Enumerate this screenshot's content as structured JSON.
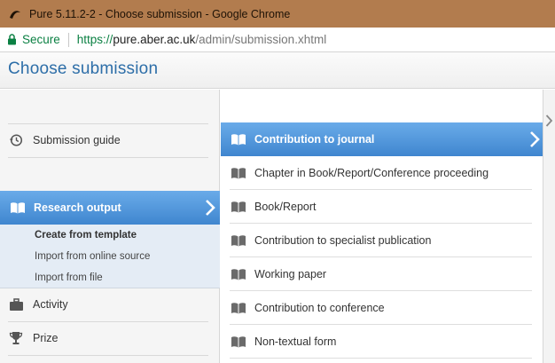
{
  "window": {
    "title": "Pure 5.11.2-2 - Choose submission - Google Chrome",
    "icon": "pure-logo-icon"
  },
  "addressbar": {
    "secure_label": "Secure",
    "url_scheme": "https://",
    "url_host": "pure.aber.ac.uk",
    "url_path": "/admin/submission.xhtml"
  },
  "page": {
    "title": "Choose submission"
  },
  "left_menu": {
    "submission_guide": {
      "label": "Submission guide",
      "icon": "history-icon"
    },
    "research_output": {
      "label": "Research output",
      "icon": "book-icon"
    },
    "sub_items": [
      {
        "label": "Create from template"
      },
      {
        "label": "Import from online source"
      },
      {
        "label": "Import from file"
      }
    ],
    "activity": {
      "label": "Activity",
      "icon": "briefcase-icon"
    },
    "prize": {
      "label": "Prize",
      "icon": "trophy-icon"
    }
  },
  "templates": {
    "active": {
      "label": "Contribution to journal",
      "icon": "book-icon"
    },
    "items": [
      {
        "label": "Chapter in Book/Report/Conference proceeding"
      },
      {
        "label": "Book/Report"
      },
      {
        "label": "Contribution to specialist publication"
      },
      {
        "label": "Working paper"
      },
      {
        "label": "Contribution to conference"
      },
      {
        "label": "Non-textual form"
      }
    ]
  },
  "colors": {
    "accent": "#4a90d9",
    "title_blue": "#2d6ea8",
    "secure_green": "#0b8043",
    "titlebar": "#b27c4e"
  }
}
